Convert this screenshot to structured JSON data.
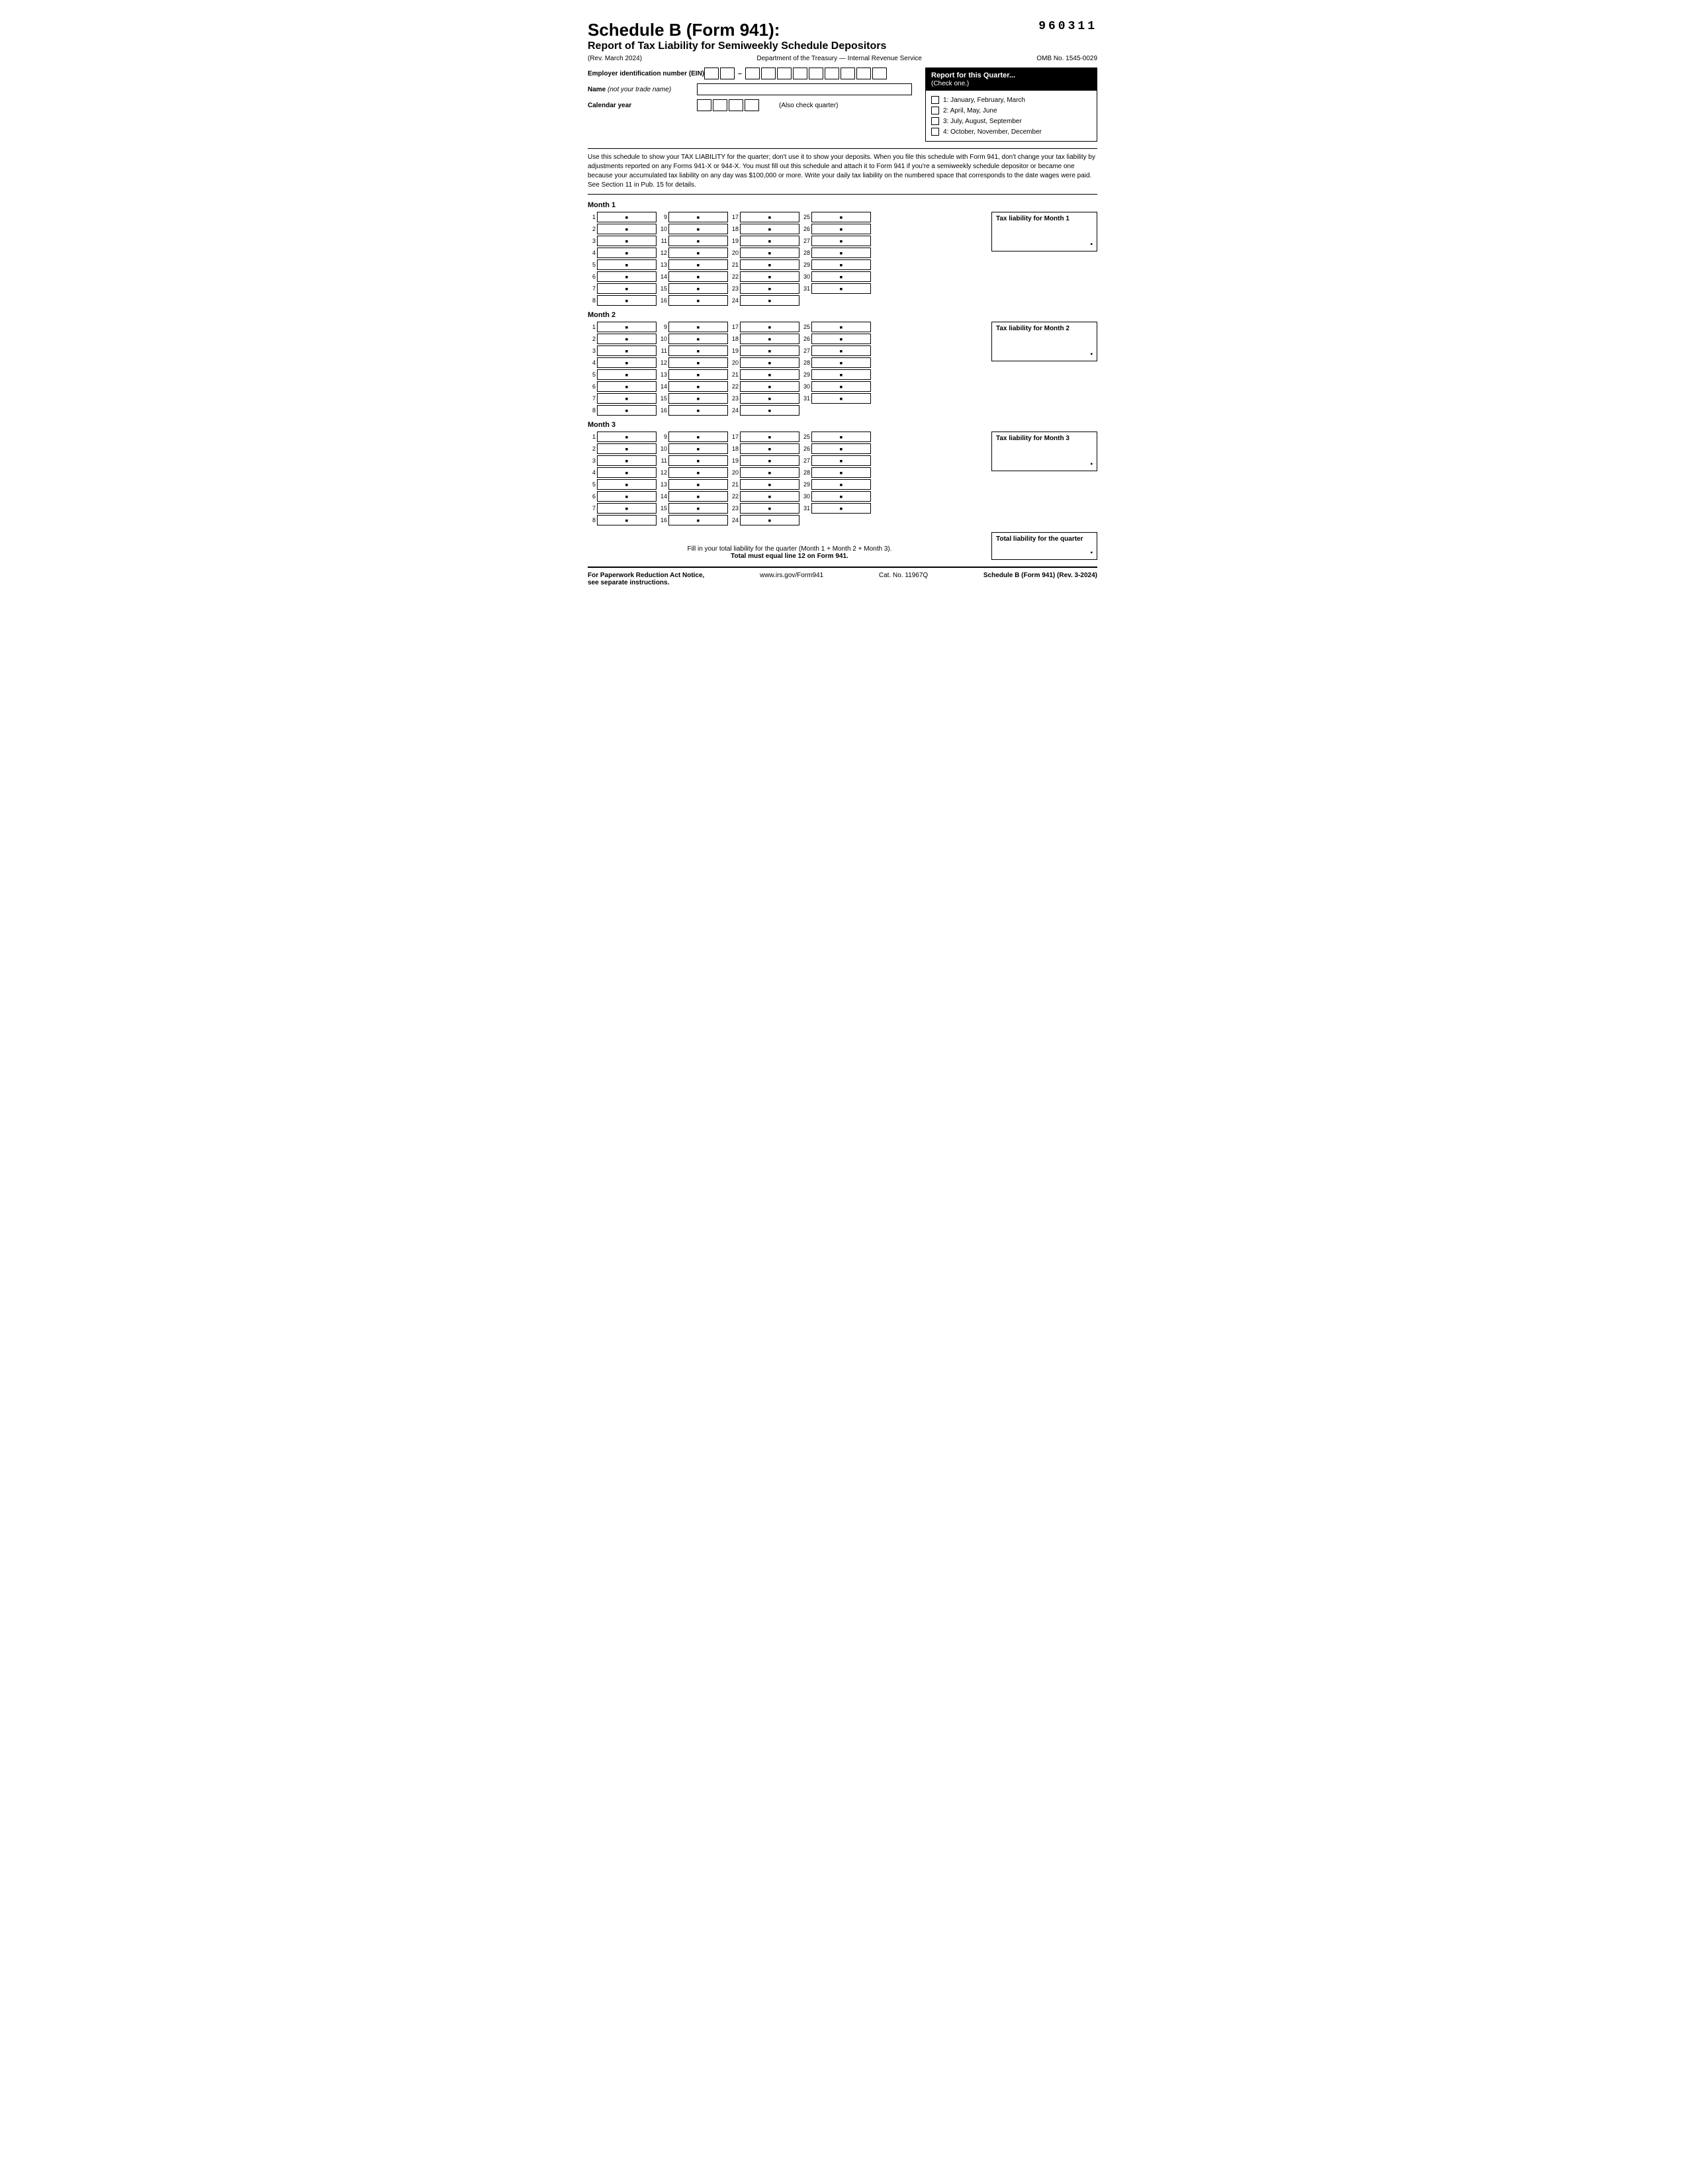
{
  "form": {
    "title": "Schedule B (Form 941):",
    "subtitle": "Report of Tax Liability for Semiweekly Schedule Depositors",
    "form_number": "960311",
    "rev": "(Rev. March 2024)",
    "dept": "Department of the Treasury — Internal Revenue Service",
    "omr_no": "OMB No. 1545-0029",
    "ein_label": "Employer identification number (EIN)",
    "name_label": "Name",
    "name_sublabel": "(not your trade name)",
    "calendar_label": "Calendar year",
    "also_check": "(Also check quarter)",
    "instructions": "Use this schedule to show your TAX LIABILITY for the quarter; don't use it to show your deposits. When you file this schedule with Form 941, don't change your tax liability by adjustments reported on any Forms 941-X or 944-X. You must fill out this schedule and attach it to Form 941 if you're a semiweekly schedule depositor or became one because your accumulated tax liability on any day was $100,000 or more. Write your daily tax liability on the numbered space that corresponds to the date wages were paid. See Section 11 in Pub. 15 for details."
  },
  "quarter": {
    "header": "Report for this Quarter...",
    "subheader": "(Check one.)",
    "options": [
      {
        "num": "1",
        "label": "1: January, February, March"
      },
      {
        "num": "2",
        "label": "2: April, May, June"
      },
      {
        "num": "3",
        "label": "3: July, August, September"
      },
      {
        "num": "4",
        "label": "4: October, November, December"
      }
    ]
  },
  "months": [
    {
      "label": "Month 1",
      "tax_liability_label": "Tax liability for Month 1",
      "days": 31
    },
    {
      "label": "Month 2",
      "tax_liability_label": "Tax liability for Month 2",
      "days": 31
    },
    {
      "label": "Month 3",
      "tax_liability_label": "Tax liability for Month 3",
      "days": 31
    }
  ],
  "footer": {
    "fill_in_text": "Fill in your total liability for the quarter (Month 1 + Month 2 + Month 3).",
    "total_must": "Total must equal line 12 on Form 941.",
    "total_quarter_label": "Total liability for the quarter",
    "paperwork_label": "For Paperwork Reduction Act Notice,",
    "paperwork_sub": "see separate instructions.",
    "website": "www.irs.gov/Form941",
    "cat_no": "Cat. No. 11967Q",
    "schedule_label": "Schedule B (Form 941) (Rev. 3-2024)"
  }
}
